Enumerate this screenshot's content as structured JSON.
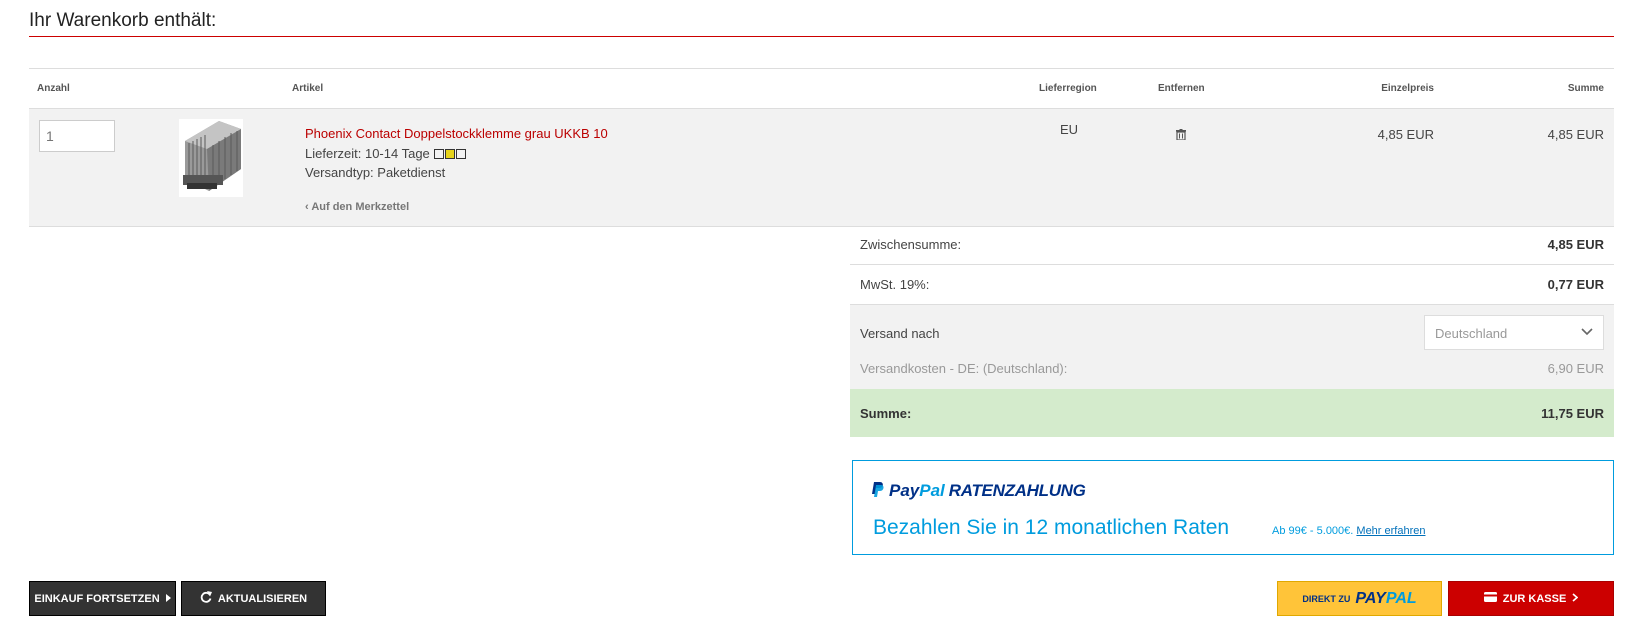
{
  "page": {
    "title": "Ihr Warenkorb enthält:"
  },
  "table": {
    "headers": {
      "qty": "Anzahl",
      "article": "Artikel",
      "region": "Lieferregion",
      "remove": "Entfernen",
      "unit_price": "Einzelpreis",
      "sum": "Summe"
    },
    "item": {
      "qty_placeholder": "1",
      "title": "Phoenix Contact Doppelstockklemme grau UKKB 10",
      "delivery": "Lieferzeit: 10-14 Tage",
      "shipping_type": "Versandtyp: Paketdienst",
      "wishlist": "Auf den Merkzettel",
      "region": "EU",
      "unit_price": "4,85 EUR",
      "sum": "4,85 EUR"
    }
  },
  "totals": {
    "subtotal_label": "Zwischensumme:",
    "subtotal": "4,85 EUR",
    "vat_label": "MwSt. 19%:",
    "vat": "0,77 EUR",
    "ship_label": "Versand nach",
    "ship_country": "Deutschland",
    "ship_cost_label": "Versandkosten - DE: (Deutschland):",
    "ship_cost": "6,90 EUR",
    "total_label": "Summe:",
    "total": "11,75 EUR"
  },
  "paypal_banner": {
    "logo_pay": "Pay",
    "logo_pal": "Pal",
    "logo_suffix": "RATENZAHLUNG",
    "headline": "Bezahlen Sie in 12 monatlichen Raten",
    "range": "Ab 99€ - 5.000€.",
    "link": "Mehr erfahren"
  },
  "buttons": {
    "continue": "EINKAUF FORTSETZEN",
    "update": "AKTUALISIEREN",
    "paypal_prefix": "DIREKT ZU",
    "paypal_pay": "PAY",
    "paypal_pal": "PAL",
    "checkout": "ZUR KASSE"
  },
  "colors": {
    "accent_red": "#cc0000",
    "paypal_blue": "#009cde",
    "paypal_yellow": "#ffc439",
    "total_green": "#d4ebcc"
  }
}
